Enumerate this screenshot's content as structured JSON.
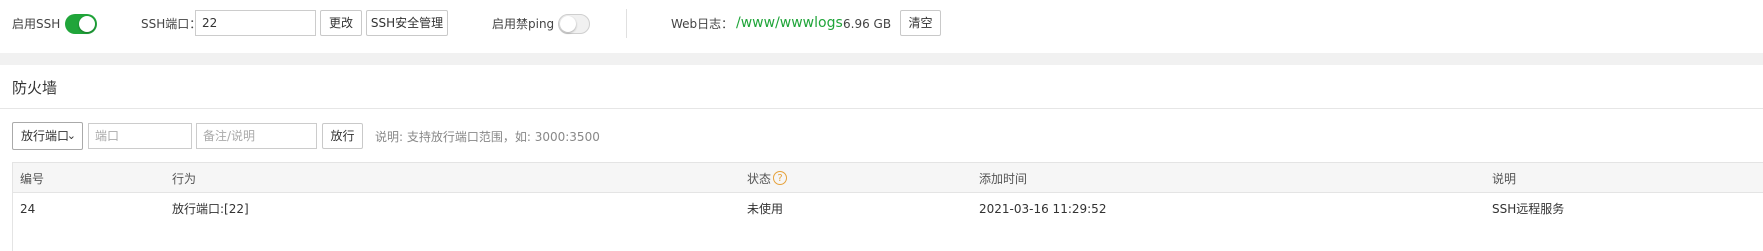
{
  "top": {
    "ssh_label": "启用SSH",
    "ssh_enabled": true,
    "ssh_port_label": "SSH端口：",
    "ssh_port_value": "22",
    "change_label": "更改",
    "ssh_security_label": "SSH安全管理",
    "ping_label": "启用禁ping",
    "ping_enabled": false,
    "weblog_label": "Web日志：",
    "weblog_path": "/www/wwwlogs",
    "weblog_size": "6.96 GB",
    "clear_label": "清空"
  },
  "firewall": {
    "title": "防火墙",
    "type_select": "放行端口",
    "port_placeholder": "端口",
    "note_placeholder": "备注/说明",
    "allow_label": "放行",
    "hint": "说明: 支持放行端口范围，如: 3000:3500",
    "table": {
      "headers": {
        "id": "编号",
        "action": "行为",
        "status": "状态",
        "status_help": "?",
        "added": "添加时间",
        "desc": "说明"
      },
      "rows": [
        {
          "id": "24",
          "action": "放行端口:[22]",
          "status": "未使用",
          "added": "2021-03-16 11:29:52",
          "desc": "SSH远程服务"
        }
      ]
    }
  },
  "colors": {
    "accent": "#20a53a",
    "help": "#e6a23c",
    "band": "#f1f1f1"
  }
}
